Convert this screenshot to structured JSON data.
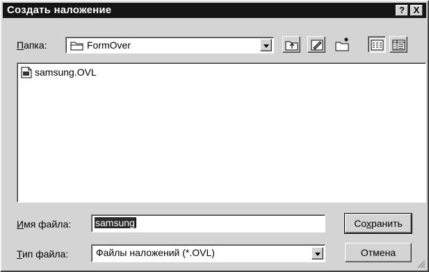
{
  "window": {
    "title": "Создать наложение",
    "help_label": "?",
    "close_label": "X"
  },
  "location": {
    "label": "Папка:",
    "label_accel": "П",
    "label_rest": "апка:",
    "folder_name": "FormOver",
    "folder_icon": "folder-icon"
  },
  "toolbar": {
    "up_folder": "up-folder-icon",
    "desktop": "desktop-icon",
    "new_folder": "new-folder-icon",
    "list_view": "list-view-icon",
    "details_view": "details-view-icon"
  },
  "files": [
    {
      "name": "samsung.OVL",
      "icon": "overlay-file-icon"
    }
  ],
  "filename": {
    "label_accel": "И",
    "label_rest": "мя файла:",
    "value": "samsung"
  },
  "filetype": {
    "label_accel": "Т",
    "label_rest": "ип файла:",
    "value": "Файлы наложений (*.OVL)"
  },
  "buttons": {
    "save_pre": "Со",
    "save_accel": "х",
    "save_post": "ранить",
    "cancel": "Отмена"
  }
}
